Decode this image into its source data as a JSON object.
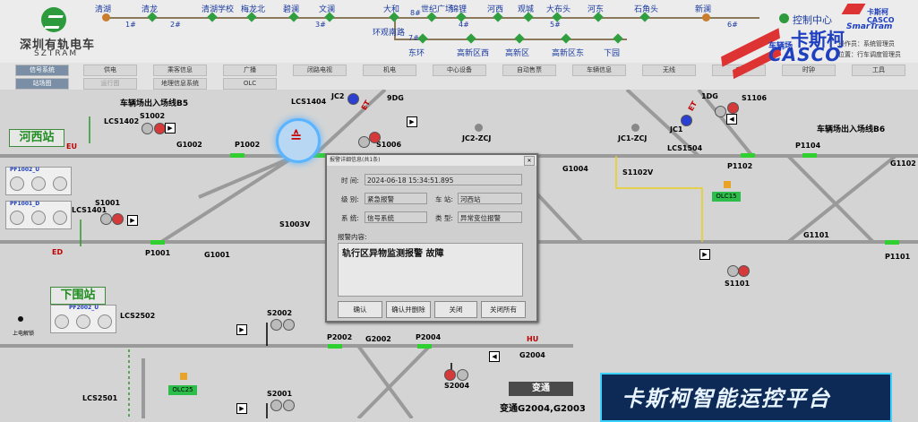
{
  "header": {
    "logo_cn": "深圳有轨电车",
    "logo_en": "SZTRAM",
    "control_center": "控制中心",
    "brand_top": "卡斯柯",
    "brand_casco": "CASCO",
    "brand_smart": "SmarTram",
    "operator_label": "操作员：系统管理员",
    "position_label": "位置：行车调度管理员"
  },
  "line": {
    "stations_top": [
      "清湖",
      "清龙",
      "清湖学校",
      "梅龙北",
      "碧澜",
      "文澜",
      "大和",
      "世纪广场",
      "锦锂",
      "河西",
      "观城",
      "大布头",
      "河东",
      "石角头",
      "新澜"
    ],
    "stations_bottom": [
      "东环",
      "高新区西",
      "高新区",
      "高新区东",
      "下园"
    ],
    "branch_station": "环观南路",
    "trains": [
      "1#",
      "2#",
      "3#",
      "4#",
      "5#",
      "6#",
      "7#",
      "8#"
    ]
  },
  "menu": {
    "row1": [
      "信号系统",
      "供电",
      "乘客信息",
      "广播",
      "闭路电视",
      "机电",
      "中心设备",
      "自动售票",
      "车辆信息",
      "无线",
      "电",
      "时钟",
      "工具"
    ],
    "row2": [
      "站场图",
      "运行图",
      "地理信息系统",
      "OLC"
    ]
  },
  "canvas": {
    "stations": [
      "河西站",
      "下围站"
    ],
    "depot_b5": "车辆场出入场线B5",
    "depot_b6": "车辆场出入场线B6",
    "depot_short": "车辆场",
    "labels": {
      "lcs1402": "LCS1402",
      "s1002": "S1002",
      "g1002": "G1002",
      "p1002": "P1002",
      "lcs1404": "LCS1404",
      "jc2": "JC2",
      "dg9": "9DG",
      "s1006": "S1006",
      "jc2zcj": "JC2-ZCJ",
      "jc1zcj": "JC1-ZCJ",
      "dg1": "1DG",
      "s1106": "S1106",
      "jc1": "JC1",
      "lcs1504": "LCS1504",
      "p1104": "P1104",
      "p1102": "P1102",
      "g1102": "G1102",
      "g1004": "G1004",
      "s1102v": "S1102V",
      "olc15": "OLC15",
      "s1003v": "S1003V",
      "g1101": "G1101",
      "p1101": "P1101",
      "s1101": "S1101",
      "s1001": "S1001",
      "lcs1401": "LCS1401",
      "p1001": "P1001",
      "g1001": "G1001",
      "eu": "EU",
      "ed": "ED",
      "pf1002u": "PF1002_U",
      "pf1001d": "PF1001_D",
      "pf2002u": "PF2002_U",
      "lcs2502": "LCS2502",
      "s2002": "S2002",
      "p2002": "P2002",
      "g2002": "G2002",
      "p2004": "P2004",
      "hu": "HU",
      "g2004": "G2004",
      "s2004": "S2004",
      "olc25": "OLC25",
      "lcs2501": "LCS2501",
      "s2001": "S2001",
      "power_on": "上电解锁",
      "et": "ET"
    },
    "switch_btn": "变通",
    "switch_status": "变通G2004,G2003",
    "banner": "卡斯柯智能运控平台"
  },
  "dialog": {
    "title": "报警详细信息(共1条)",
    "time_label": "时  间:",
    "time_value": "2024-06-18 15:34:51.895",
    "level_label": "级  别:",
    "level_value": "紧急报警",
    "station_label": "车  站:",
    "station_value": "河西站",
    "system_label": "系  统:",
    "system_value": "信号系统",
    "type_label": "类  型:",
    "type_value": "异常变位报警",
    "content_label": "报警内容:",
    "content_value": "轨行区异物监测报警 故障",
    "btn_confirm": "确认",
    "btn_confirm_delete": "确认并删除",
    "btn_close": "关闭",
    "btn_close_all": "关闭所有"
  }
}
